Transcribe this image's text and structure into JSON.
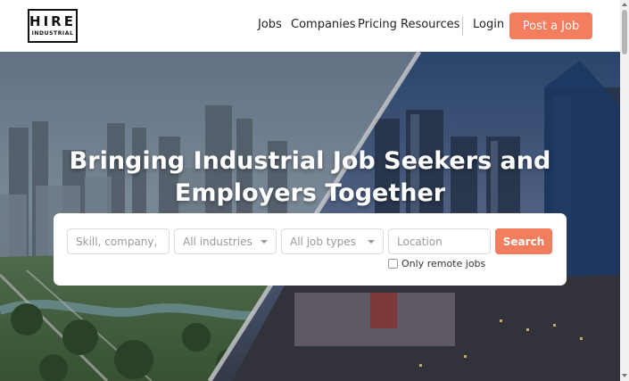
{
  "logo": {
    "main": "HIRE",
    "sub": "INDUSTRIAL"
  },
  "nav": {
    "items": [
      {
        "label": "Jobs"
      },
      {
        "label": "Companies"
      },
      {
        "label": "Pricing"
      },
      {
        "label": "Resources"
      }
    ],
    "login_label": "Login",
    "post_job_label": "Post a Job"
  },
  "hero": {
    "headline_line1": "Bringing Industrial Job Seekers and",
    "headline_line2": "Employers Together",
    "background": "city-skyline-split-photo"
  },
  "search": {
    "keyword_placeholder": "Skill, company, ta",
    "industry_selected": "All industries",
    "job_type_selected": "All job types",
    "location_placeholder": "Location",
    "button_label": "Search",
    "remote_label": "Only remote jobs",
    "remote_checked": false
  },
  "colors": {
    "accent": "#f27e5f",
    "header_bg": "#ffffff",
    "text": "#222222"
  }
}
